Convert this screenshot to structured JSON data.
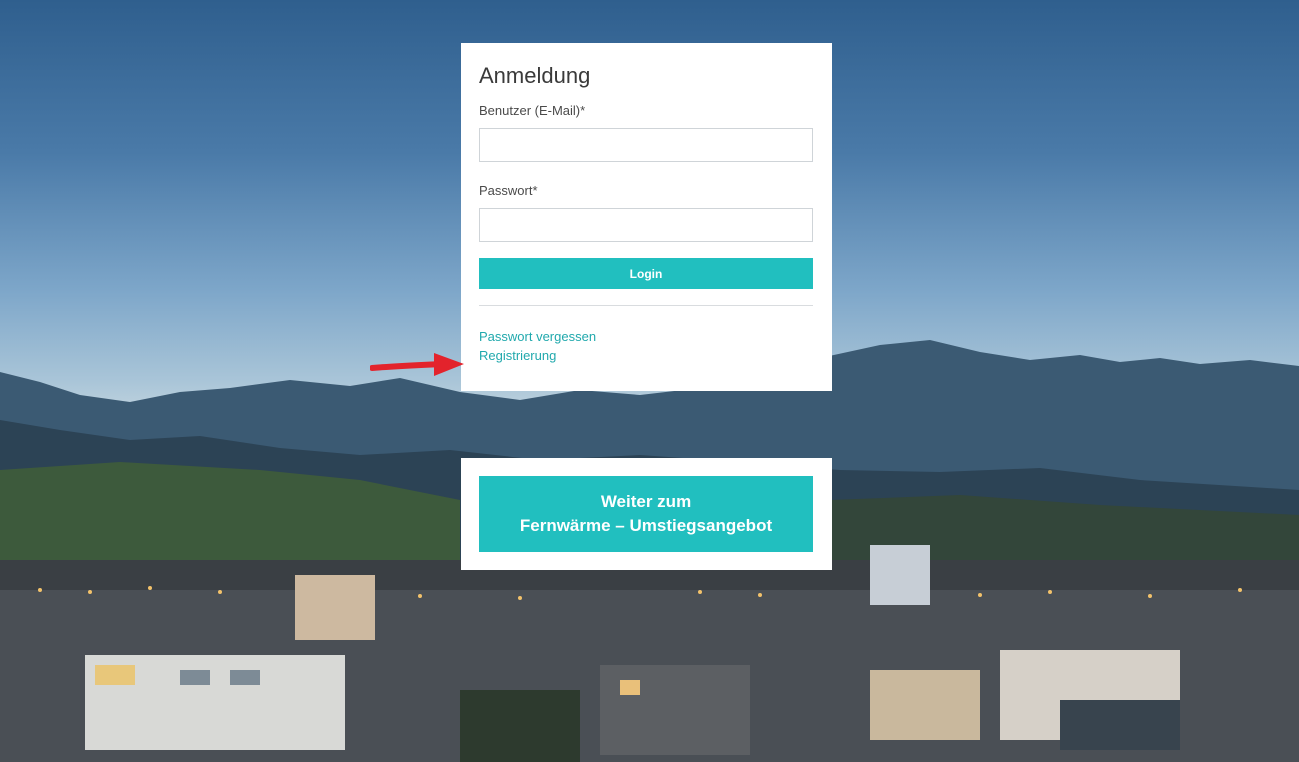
{
  "login": {
    "title": "Anmeldung",
    "user_label": "Benutzer (E-Mail)*",
    "user_value": "",
    "password_label": "Passwort*",
    "password_value": "",
    "login_button": "Login",
    "forgot_password_link": "Passwort vergessen",
    "register_link": "Registrierung"
  },
  "offer": {
    "button_line1": "Weiter zum",
    "button_line2": "Fernwärme – Umstiegsangebot"
  },
  "colors": {
    "accent": "#21bfbf",
    "link": "#21a9ad",
    "annotation_arrow": "#e3232c"
  },
  "icons": {
    "annotation": "red-arrow-icon"
  }
}
